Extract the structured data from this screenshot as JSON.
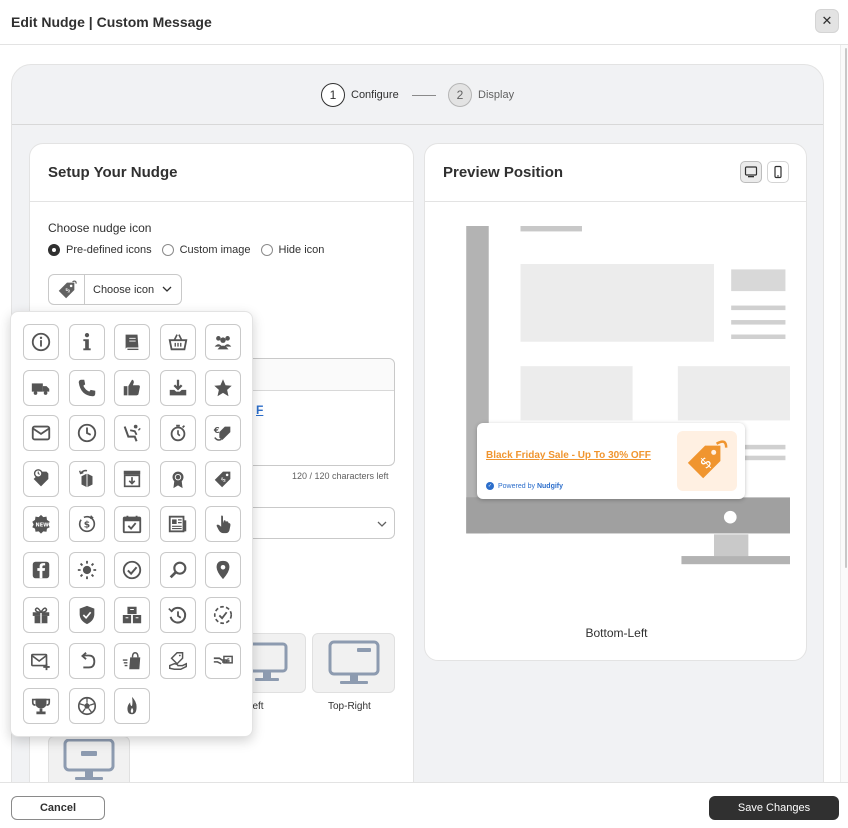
{
  "modal": {
    "title": "Edit Nudge | Custom Message",
    "close_symbol": "✕"
  },
  "stepper": {
    "steps": [
      {
        "number": "1",
        "label": "Configure"
      },
      {
        "number": "2",
        "label": "Display"
      }
    ]
  },
  "setup": {
    "title": "Setup Your Nudge",
    "icon_label": "Choose nudge icon",
    "radio_options": [
      {
        "label": "Pre-defined icons"
      },
      {
        "label": "Custom image"
      },
      {
        "label": "Hide icon"
      }
    ],
    "choose_icon_label": "Choose icon",
    "message_link_fragment": "F",
    "char_count": "120 / 120 characters left",
    "position_tiles": [
      {
        "label": "p-Left"
      },
      {
        "label": "Top-Right"
      }
    ]
  },
  "preview": {
    "title": "Preview Position",
    "nudge_message": "Black Friday Sale - Up To 30% OFF",
    "powered_by_prefix": "Powered by",
    "powered_by_brand": "Nudgify",
    "position_label": "Bottom-Left"
  },
  "icon_grid": {
    "icons": [
      "info-circle-icon",
      "info-icon",
      "book-icon",
      "basket-icon",
      "users-icon",
      "truck-icon",
      "phone-icon",
      "thumbs-up-icon",
      "download-icon",
      "star-icon",
      "envelope-icon",
      "clock-icon",
      "seat-icon",
      "stopwatch-icon",
      "euro-tag-icon",
      "timer-tag-icon",
      "return-box-icon",
      "store-download-icon",
      "award-icon",
      "dollar-tag-icon",
      "new-badge-icon",
      "dollar-cycle-icon",
      "calendar-check-icon",
      "newspaper-icon",
      "hand-pointer-icon",
      "facebook-icon",
      "sun-icon",
      "check-circle-icon",
      "search-icon",
      "location-pin-icon",
      "gift-icon",
      "shield-icon",
      "boxes-icon",
      "history-icon",
      "check-dashed-icon",
      "mail-plus-icon",
      "undo-icon",
      "fast-bag-icon",
      "tag-hand-icon",
      "dollar-hand-icon",
      "trophy-icon",
      "soccer-ball-icon",
      "fire-icon"
    ]
  },
  "footer": {
    "cancel_label": "Cancel",
    "save_label": "Save Changes"
  },
  "colors": {
    "accent_orange": "#f0952f",
    "primary_dark": "#303030",
    "link_blue": "#2c6ecb"
  }
}
